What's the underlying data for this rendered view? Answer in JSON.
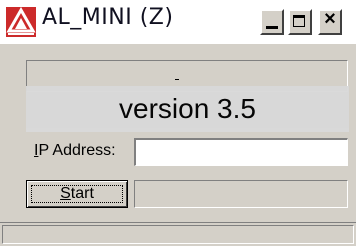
{
  "window": {
    "title": "AL_MINI (Z)",
    "icon": "al-logo-icon",
    "controls": {
      "minimize": "minimize-icon",
      "maximize": "maximize-icon",
      "close": "close-icon"
    }
  },
  "main": {
    "top_panel_text": "-",
    "version_banner": "version 3.5",
    "ip_label_accel": "I",
    "ip_label_rest": "P Address:",
    "ip_value": "",
    "start_button_accel": "S",
    "start_button_rest": "tart",
    "status_text": ""
  },
  "colors": {
    "face": "#d4d0c8",
    "logo_red": "#cc2a2a"
  }
}
